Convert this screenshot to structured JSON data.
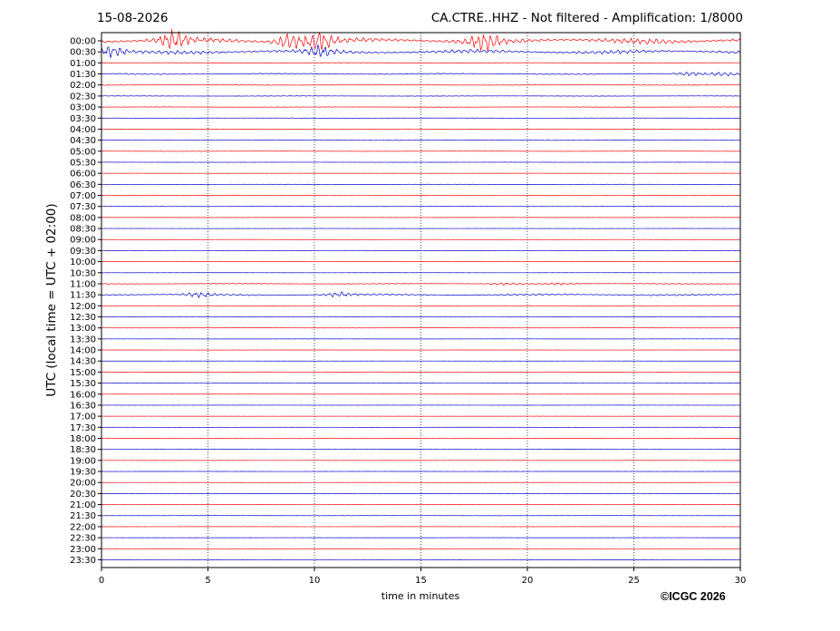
{
  "header": {
    "date": "15-08-2026",
    "station_info": "CA.CTRE..HHZ - Not filtered - Amplification: 1/8000"
  },
  "footer": {
    "copyright": "©ICGC 2026"
  },
  "chart_data": {
    "type": "line",
    "title": "CA.CTRE..HHZ - Not filtered - Amplification: 1/8000",
    "date": "15-08-2026",
    "xlabel": "time in minutes",
    "ylabel": "UTC (local time = UTC + 02:00)",
    "xlim": [
      0,
      30
    ],
    "x_ticks": [
      0,
      5,
      10,
      15,
      20,
      25,
      30
    ],
    "vertical_gridlines_at": [
      5,
      10,
      15,
      20,
      25
    ],
    "trace_colors": [
      "#ff0000",
      "#0000cc"
    ],
    "row_labels": [
      "00:00",
      "00:30",
      "01:00",
      "01:30",
      "02:00",
      "02:30",
      "03:00",
      "03:30",
      "04:00",
      "04:30",
      "05:00",
      "05:30",
      "06:00",
      "06:30",
      "07:00",
      "07:30",
      "08:00",
      "08:30",
      "09:00",
      "09:30",
      "10:00",
      "10:30",
      "11:00",
      "11:30",
      "12:00",
      "12:30",
      "13:00",
      "13:30",
      "14:00",
      "14:30",
      "15:00",
      "15:30",
      "16:00",
      "16:30",
      "17:00",
      "17:30",
      "18:00",
      "18:30",
      "19:00",
      "19:30",
      "20:00",
      "20:30",
      "21:00",
      "21:30",
      "22:00",
      "22:30",
      "23:00",
      "23:30"
    ],
    "row_activity": [
      {
        "row": "00:00",
        "level": 1.0,
        "bursts_min": [
          3.4,
          8.8,
          10.2,
          18
        ]
      },
      {
        "row": "00:30",
        "level": 0.7,
        "bursts_min": [
          0.5,
          10.3
        ]
      },
      {
        "row": "01:00",
        "level": 0.12
      },
      {
        "row": "01:30",
        "level": 0.22,
        "bursts_min": [
          27.5,
          29.2
        ]
      },
      {
        "row": "02:00",
        "level": 0.12
      },
      {
        "row": "02:30",
        "level": 0.08
      },
      {
        "row": "03:00",
        "level": 0.08
      },
      {
        "row": "03:30",
        "level": 0.05
      },
      {
        "row": "04:00",
        "level": 0.06
      },
      {
        "row": "04:30",
        "level": 0.1
      },
      {
        "row": "05:00",
        "level": 0.08
      },
      {
        "row": "05:30",
        "level": 0.04
      },
      {
        "row": "06:00",
        "level": 0.04
      },
      {
        "row": "06:30",
        "level": 0.04
      },
      {
        "row": "07:00",
        "level": 0.05
      },
      {
        "row": "07:30",
        "level": 0.04
      },
      {
        "row": "08:00",
        "level": 0.03
      },
      {
        "row": "08:30",
        "level": 0.03
      },
      {
        "row": "09:00",
        "level": 0.03
      },
      {
        "row": "09:30",
        "level": 0.03
      },
      {
        "row": "10:00",
        "level": 0.04
      },
      {
        "row": "10:30",
        "level": 0.03
      },
      {
        "row": "11:00",
        "level": 0.14,
        "bursts_min": [
          19,
          21.5
        ]
      },
      {
        "row": "11:30",
        "level": 0.3,
        "bursts_min": [
          4.6,
          11.2
        ]
      },
      {
        "row": "12:00",
        "level": 0.06
      },
      {
        "row": "12:30",
        "level": 0.05
      },
      {
        "row": "13:00",
        "level": 0.04
      },
      {
        "row": "13:30",
        "level": 0.03
      },
      {
        "row": "14:00",
        "level": 0.03
      },
      {
        "row": "14:30",
        "level": 0.03
      },
      {
        "row": "15:00",
        "level": 0.03
      },
      {
        "row": "15:30",
        "level": 0.03
      },
      {
        "row": "16:00",
        "level": 0.03
      },
      {
        "row": "16:30",
        "level": 0.03
      },
      {
        "row": "17:00",
        "level": 0.03
      },
      {
        "row": "17:30",
        "level": 0.03
      },
      {
        "row": "18:00",
        "level": 0.03
      },
      {
        "row": "18:30",
        "level": 0.04
      },
      {
        "row": "19:00",
        "level": 0.03
      },
      {
        "row": "19:30",
        "level": 0.03
      },
      {
        "row": "20:00",
        "level": 0.03
      },
      {
        "row": "20:30",
        "level": 0.03
      },
      {
        "row": "21:00",
        "level": 0.03
      },
      {
        "row": "21:30",
        "level": 0.04
      },
      {
        "row": "22:00",
        "level": 0.03
      },
      {
        "row": "22:30",
        "level": 0.03
      },
      {
        "row": "23:00",
        "level": 0.03
      },
      {
        "row": "23:30",
        "level": 0.03
      }
    ]
  }
}
